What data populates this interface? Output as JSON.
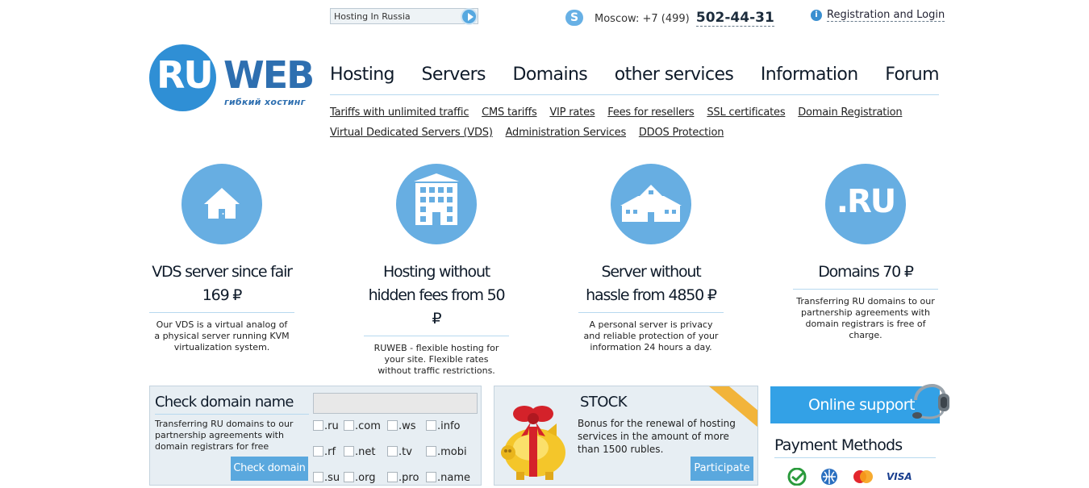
{
  "search": {
    "value": "Hosting In Russia"
  },
  "contact": {
    "city_prefix": "Moscow: +7 (499)",
    "number": "502-44-31"
  },
  "auth": {
    "link_label": "Registration and Login"
  },
  "logo": {
    "ru": "RU",
    "web": "WEB",
    "tagline": "гибкий хостинг"
  },
  "nav": {
    "items": [
      {
        "label": "Hosting"
      },
      {
        "label": "Servers"
      },
      {
        "label": "Domains"
      },
      {
        "label": "other services"
      },
      {
        "label": "Information"
      },
      {
        "label": "Forum"
      }
    ]
  },
  "subnav": {
    "links": [
      {
        "label": "Tariffs with unlimited traffic"
      },
      {
        "label": "CMS tariffs"
      },
      {
        "label": "VIP rates"
      },
      {
        "label": "Fees for resellers"
      },
      {
        "label": "SSL certificates"
      },
      {
        "label": "Domain Registration"
      },
      {
        "label": "Virtual Dedicated Servers (VDS)"
      },
      {
        "label": "Administration Services"
      },
      {
        "label": "DDOS Protection"
      }
    ]
  },
  "features": [
    {
      "icon": "house-icon",
      "title": "VDS server since fair 169 ₽",
      "text": "Our VDS is a virtual analog of a physical server running KVM virtualization system."
    },
    {
      "icon": "apartment-building-icon",
      "title": "Hosting without hidden fees from 50 ₽",
      "text": "RUWEB - flexible hosting for your site. Flexible rates without traffic restrictions."
    },
    {
      "icon": "mansion-icon",
      "title": "Server without hassle from 4850 ₽",
      "text": "A personal server is privacy and reliable protection of your information 24 hours a day."
    },
    {
      "icon": "ru-domain-icon",
      "icon_text": ".RU",
      "title": "Domains 70 ₽",
      "text": "Transferring RU domains to our partnership agreements with domain registrars is free of charge."
    }
  ],
  "domain_check": {
    "title": "Check domain name",
    "desc": "Transferring RU domains to our partnership agreements with domain registrars for free",
    "button": "Check domain",
    "tlds": [
      ".ru",
      ".com",
      ".ws",
      ".info",
      ".rf",
      ".net",
      ".tv",
      ".mobi",
      ".su",
      ".org",
      ".pro",
      ".name"
    ]
  },
  "stock": {
    "title": "STOCK",
    "desc": "Bonus for the renewal of hosting services in the amount of more than 1500 rubles.",
    "button": "Participate"
  },
  "support": {
    "label": "Online support"
  },
  "payment": {
    "title": "Payment Methods",
    "methods": [
      "sberbank-icon",
      "webmoney-icon",
      "mastercard-icon",
      "visa-icon"
    ],
    "visa_text": "VISA"
  },
  "colors": {
    "accent": "#5aa8de",
    "icon_circle": "#67aee2",
    "logo_blue": "#2f8fd5",
    "support": "#33a1e6",
    "box_bg": "#e7eef3"
  }
}
